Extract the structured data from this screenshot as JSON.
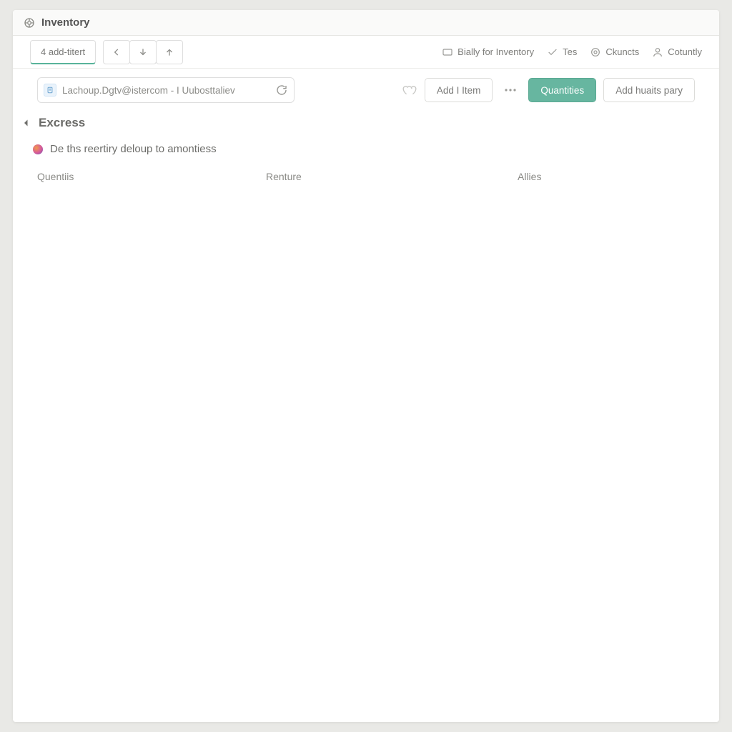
{
  "titlebar": {
    "title": "Inventory"
  },
  "toolbar": {
    "tab_label": "4 add-titert",
    "links": {
      "ready": "Bially for Inventory",
      "tes": "Tes",
      "counts": "Ckuncts",
      "cotuntly": "Cotuntly"
    }
  },
  "subbar": {
    "address_text": "Lachoup.Dgtv@istercom - I  Uubosttaliev",
    "add_item_label": "Add I Item",
    "primary_label": "Quantities",
    "secondary_label": "Add huaits pary"
  },
  "section": {
    "title": "Excress"
  },
  "info": {
    "text": "De ths reertiry deloup to amontiess"
  },
  "columns": {
    "c1": "Quentiis",
    "c2": "Renture",
    "c3": "Allies"
  }
}
